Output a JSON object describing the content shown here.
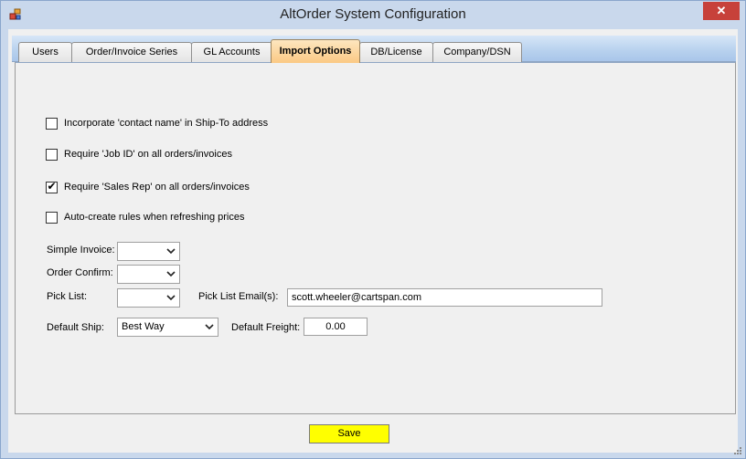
{
  "window": {
    "title": "AltOrder System Configuration",
    "close_glyph": "✕"
  },
  "tabs": [
    {
      "label": "Users",
      "active": false
    },
    {
      "label": "Order/Invoice Series",
      "active": false
    },
    {
      "label": "GL Accounts",
      "active": false
    },
    {
      "label": "Import Options",
      "active": true
    },
    {
      "label": "DB/License",
      "active": false
    },
    {
      "label": "Company/DSN",
      "active": false
    }
  ],
  "options": [
    {
      "label": "Incorporate 'contact name' in Ship-To address",
      "checked": false
    },
    {
      "label": "Require 'Job ID' on all orders/invoices",
      "checked": false
    },
    {
      "label": "Require 'Sales Rep' on all orders/invoices",
      "checked": true
    },
    {
      "label": "Auto-create rules when refreshing prices",
      "checked": false
    }
  ],
  "fields": {
    "simple_invoice": {
      "label": "Simple Invoice:",
      "value": ""
    },
    "order_confirm": {
      "label": "Order Confirm:",
      "value": ""
    },
    "pick_list": {
      "label": "Pick List:",
      "value": ""
    },
    "pick_list_email": {
      "label": "Pick List Email(s):",
      "value": "scott.wheeler@cartspan.com"
    },
    "default_ship": {
      "label": "Default Ship:",
      "value": "Best Way"
    },
    "default_freight": {
      "label": "Default Freight:",
      "value": "0.00"
    }
  },
  "footer": {
    "save_label": "Save"
  },
  "check_glyph": "✔",
  "colors": {
    "active_tab": "#fbc984",
    "save_button": "#ffff00",
    "close_button": "#c7413a"
  }
}
